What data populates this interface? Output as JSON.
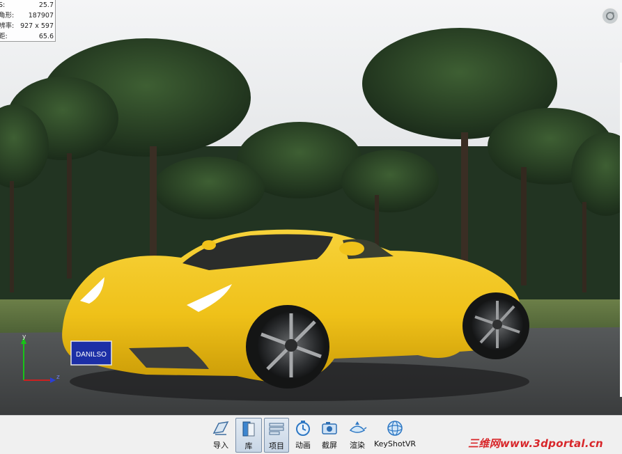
{
  "stats": {
    "rows": [
      {
        "key": "S:",
        "value": "25.7"
      },
      {
        "key": "角形:",
        "value": "187907"
      },
      {
        "key": "辨率:",
        "value": "927 x 597"
      },
      {
        "key": "距:",
        "value": "65.6"
      }
    ]
  },
  "scene": {
    "license_plate": "DANILSO",
    "car_color": "#f2c617",
    "axis_y_label": "y",
    "axis_z_label": "z"
  },
  "toolbar": {
    "items": [
      {
        "label": "导入",
        "icon": "import-icon"
      },
      {
        "label": "库",
        "icon": "library-icon"
      },
      {
        "label": "项目",
        "icon": "project-icon"
      },
      {
        "label": "动画",
        "icon": "animation-icon"
      },
      {
        "label": "截屏",
        "icon": "screenshot-icon"
      },
      {
        "label": "渲染",
        "icon": "render-icon"
      },
      {
        "label": "KeyShotVR",
        "icon": "keyshotvr-icon"
      }
    ]
  },
  "watermark": "三维网www.3dportal.cn"
}
